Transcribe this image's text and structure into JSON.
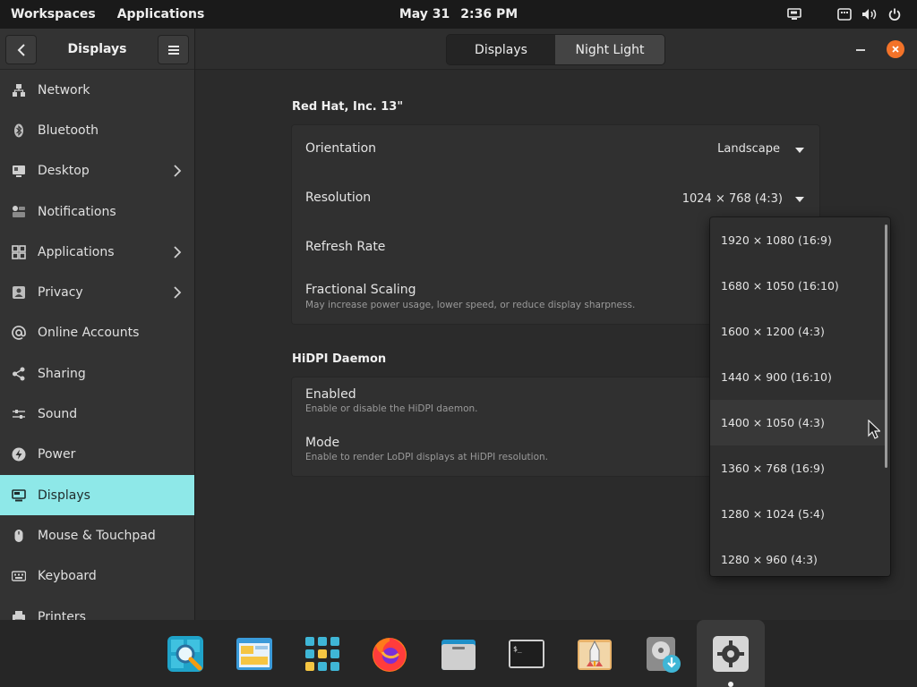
{
  "top_panel": {
    "workspaces": "Workspaces",
    "applications": "Applications",
    "date": "May 31",
    "time": "2:36 PM"
  },
  "sidebar": {
    "title": "Displays",
    "items": [
      {
        "label": "Network",
        "icon": "network-icon"
      },
      {
        "label": "Bluetooth",
        "icon": "bluetooth-icon"
      },
      {
        "label": "Desktop",
        "icon": "desktop-icon",
        "has_submenu": true
      },
      {
        "label": "Notifications",
        "icon": "notifications-icon"
      },
      {
        "label": "Applications",
        "icon": "applications-icon",
        "has_submenu": true
      },
      {
        "label": "Privacy",
        "icon": "privacy-icon",
        "has_submenu": true
      },
      {
        "label": "Online Accounts",
        "icon": "online-accounts-icon"
      },
      {
        "label": "Sharing",
        "icon": "sharing-icon"
      },
      {
        "label": "Sound",
        "icon": "sound-icon"
      },
      {
        "label": "Power",
        "icon": "power-icon"
      },
      {
        "label": "Displays",
        "icon": "displays-icon",
        "active": true
      },
      {
        "label": "Mouse & Touchpad",
        "icon": "mouse-icon"
      },
      {
        "label": "Keyboard",
        "icon": "keyboard-icon"
      },
      {
        "label": "Printers",
        "icon": "printer-icon"
      }
    ],
    "active_color": "#8ee8e8"
  },
  "header": {
    "tabs": [
      "Displays",
      "Night Light"
    ],
    "active_tab": "Displays"
  },
  "display": {
    "name": "Red Hat, Inc. 13\"",
    "orientation_label": "Orientation",
    "orientation_value": "Landscape",
    "resolution_label": "Resolution",
    "resolution_value": "1024 × 768 (4:3)",
    "refresh_label": "Refresh Rate",
    "scaling_label": "Fractional Scaling",
    "scaling_desc": "May increase power usage, lower speed, or reduce display sharpness."
  },
  "hidpi": {
    "title": "HiDPI Daemon",
    "enabled_label": "Enabled",
    "enabled_desc": "Enable or disable the HiDPI daemon.",
    "mode_label": "Mode",
    "mode_desc": "Enable to render LoDPI displays at HiDPI resolution."
  },
  "resolution_options": [
    "1920 × 1080 (16:9)",
    "1680 × 1050 (16:10)",
    "1600 × 1200 (4:3)",
    "1440 × 900 (16:10)",
    "1400 × 1050 (4:3)",
    "1360 × 768 (16:9)",
    "1280 × 1024 (5:4)",
    "1280 × 960 (4:3)"
  ],
  "hovered_option": "1400 × 1050 (4:3)",
  "dock": {
    "items": [
      "search-app-icon",
      "files-app-icon",
      "app-grid-icon",
      "firefox-icon",
      "file-manager-icon",
      "terminal-icon",
      "installer-icon",
      "disk-utility-icon",
      "settings-icon"
    ],
    "active": "settings-icon"
  },
  "colors": {
    "accent": "#8ee8e8",
    "close": "#f37329"
  }
}
